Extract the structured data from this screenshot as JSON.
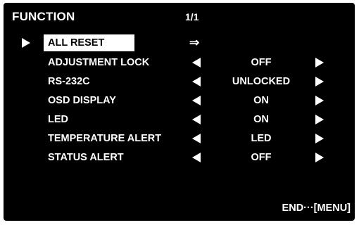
{
  "menu": {
    "title": "FUNCTION",
    "page_indicator": "1/1",
    "enter_symbol": "⇒",
    "items": [
      {
        "label": "ALL RESET",
        "selected": true
      },
      {
        "label": "ADJUSTMENT LOCK",
        "value": "OFF"
      },
      {
        "label": "RS-232C",
        "value": "UNLOCKED"
      },
      {
        "label": "OSD DISPLAY",
        "value": "ON"
      },
      {
        "label": "LED",
        "value": "ON"
      },
      {
        "label": "TEMPERATURE ALERT",
        "value": "LED"
      },
      {
        "label": "STATUS ALERT",
        "value": "OFF"
      }
    ],
    "footer": "END···[MENU]"
  },
  "colors": {
    "background": "#000000",
    "text": "#ffffff",
    "highlight": "#ffffff"
  }
}
